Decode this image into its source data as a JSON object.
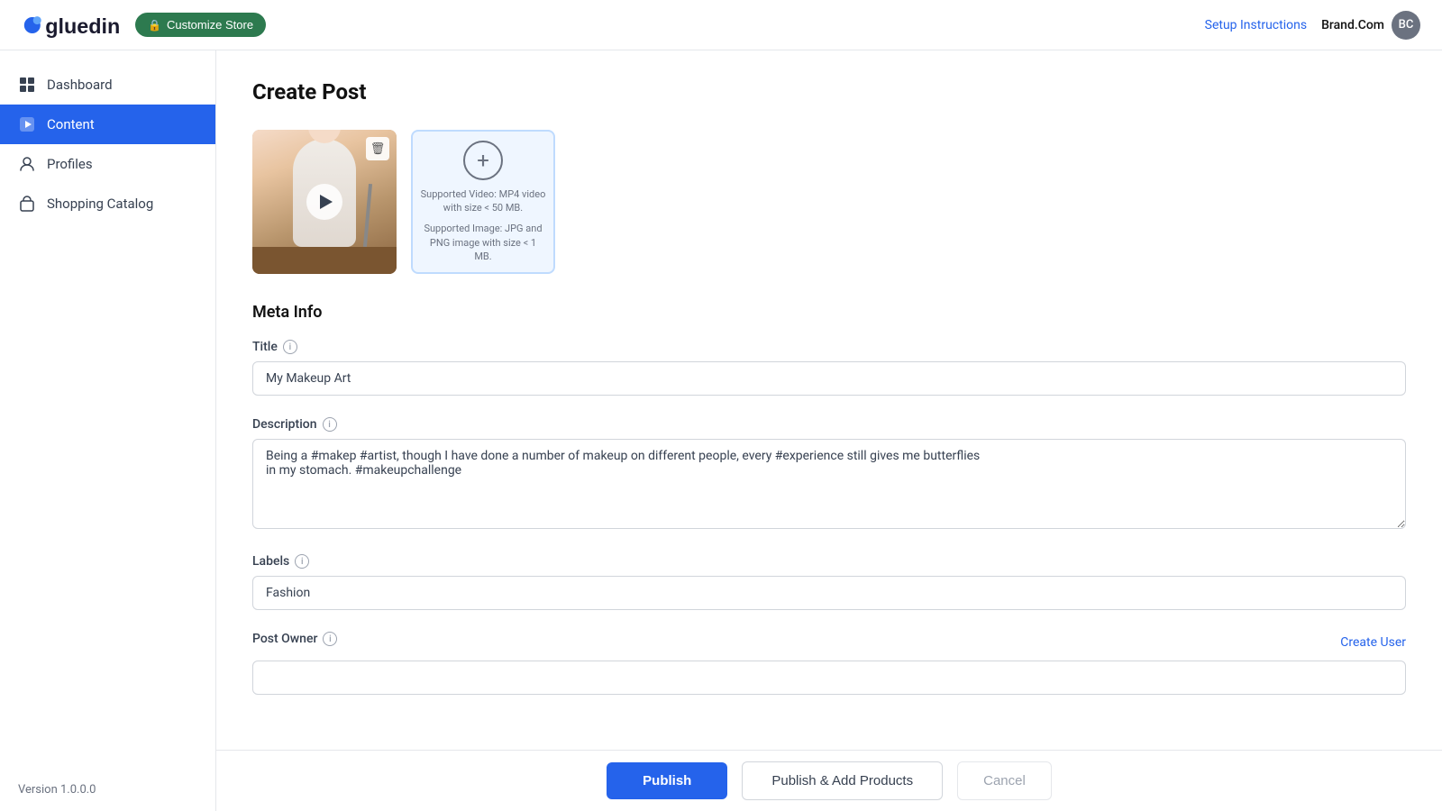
{
  "header": {
    "logo_text": "gluedin",
    "customize_btn": "Customize Store",
    "setup_link": "Setup Instructions",
    "user_name": "Brand.Com"
  },
  "sidebar": {
    "items": [
      {
        "id": "dashboard",
        "label": "Dashboard",
        "icon": "grid"
      },
      {
        "id": "content",
        "label": "Content",
        "icon": "play",
        "active": true
      },
      {
        "id": "profiles",
        "label": "Profiles",
        "icon": "person"
      },
      {
        "id": "shopping",
        "label": "Shopping Catalog",
        "icon": "bag"
      }
    ],
    "version": "Version 1.0.0.0"
  },
  "main": {
    "page_title": "Create Post",
    "media": {
      "upload_hint_video": "Supported Video: MP4 video with size < 50 MB.",
      "upload_hint_image": "Supported Image: JPG and PNG image with size < 1 MB."
    },
    "meta_section_title": "Meta Info",
    "form": {
      "title_label": "Title",
      "title_value": "My Makeup Art",
      "title_placeholder": "My Makeup Art",
      "description_label": "Description",
      "description_value": "Being a #makep #artist, though I have done a number of makeup on different people, every #experience still gives me butterflies in my stomach. #makeupchallenge",
      "labels_label": "Labels",
      "labels_value": "Fashion",
      "post_owner_label": "Post Owner",
      "create_user_link": "Create User"
    }
  },
  "footer": {
    "publish_btn": "Publish",
    "publish_add_btn": "Publish & Add Products",
    "cancel_btn": "Cancel"
  }
}
